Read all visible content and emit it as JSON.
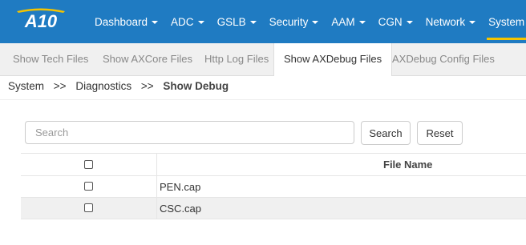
{
  "brand": {
    "logo_text": "A10",
    "nav_color": "#1f7bc2",
    "active_underline_color": "#f5c400"
  },
  "topnav": {
    "items": [
      {
        "label": "Dashboard",
        "active": false
      },
      {
        "label": "ADC",
        "active": false
      },
      {
        "label": "GSLB",
        "active": false
      },
      {
        "label": "Security",
        "active": false
      },
      {
        "label": "AAM",
        "active": false
      },
      {
        "label": "CGN",
        "active": false
      },
      {
        "label": "Network",
        "active": false
      },
      {
        "label": "System",
        "active": true
      }
    ]
  },
  "subnav": {
    "tabs": [
      {
        "label": "Show Tech Files",
        "active": false
      },
      {
        "label": "Show AXCore Files",
        "active": false
      },
      {
        "label": "Http Log Files",
        "active": false
      },
      {
        "label": "Show AXDebug Files",
        "active": true
      },
      {
        "label": "AXDebug Config Files",
        "active": false
      }
    ]
  },
  "breadcrumb": {
    "items": [
      "System",
      "Diagnostics"
    ],
    "separator": ">>",
    "current": "Show Debug"
  },
  "search": {
    "placeholder": "Search",
    "value": "",
    "search_label": "Search",
    "reset_label": "Reset"
  },
  "table": {
    "columns": [
      "",
      "File Name"
    ],
    "rows": [
      {
        "checked": false,
        "file_name": "PEN.cap"
      },
      {
        "checked": false,
        "file_name": "CSC.cap"
      }
    ]
  }
}
